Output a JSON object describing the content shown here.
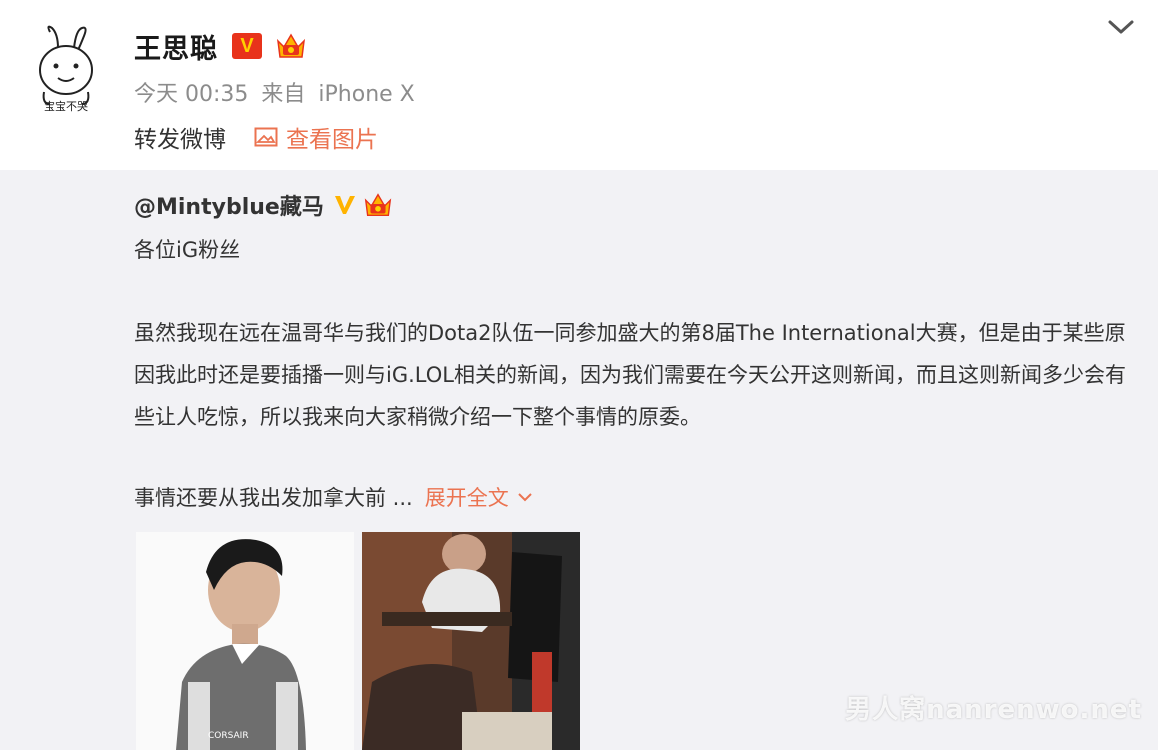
{
  "post": {
    "author": "王思聪",
    "time": "今天 00:35",
    "source_prefix": "来自",
    "source_device": "iPhone X",
    "repost_label": "转发微博",
    "view_pictures": "查看图片",
    "avatar_caption": "宝宝不哭"
  },
  "retweet": {
    "author": "@Mintyblue藏马",
    "greeting": "各位iG粉丝",
    "paragraph": "虽然我现在远在温哥华与我们的Dota2队伍一同参加盛大的第8届The International大赛，但是由于某些原因我此时还是要插播一则与iG.LOL相关的新闻，因为我们需要在今天公开这则新闻，而且这则新闻多少会有些让人吃惊，所以我来向大家稍微介绍一下整个事情的原委。",
    "more_text": "事情还要从我出发加拿大前 ...",
    "expand_label": "展开全文"
  },
  "watermark": "男人窝nanrenwo.net",
  "colors": {
    "accent": "#eb7350",
    "verified_red": "#e8331b",
    "verified_gold": "#ffb300",
    "retweet_bg": "#f2f2f5",
    "meta_gray": "#8c8c8c"
  },
  "icons": {
    "dropdown": "chevron-down-icon",
    "picture": "image-icon",
    "verified": "verified-v-icon",
    "member": "crown-badge-icon"
  }
}
